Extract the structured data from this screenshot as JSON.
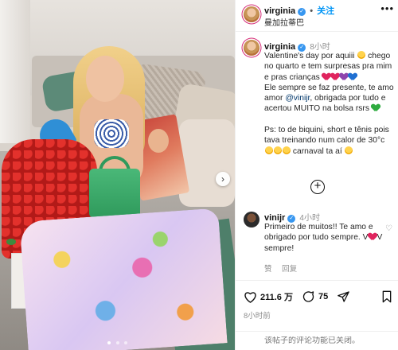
{
  "post": {
    "username": "virginia",
    "follow_label": "关注",
    "location": "曼加拉蒂巴",
    "verified_mark": "✓"
  },
  "caption": {
    "username": "virginia",
    "time": "8小时",
    "line1": "Valentine's day por aquiii ",
    "line2": " chego no quarto e tem surpresas pra mim e pras crianças ",
    "line3": "\nEle sempre se faz presente, te amo amor ",
    "mention": "@vinijr",
    "line4": ", obrigada por tudo e acertou MUITO na bolsa rsrs ",
    "line5": "\n\nPs: to de biquini, short e tênis pois tava treinando num calor de 30°c ",
    "line6": " carnaval ta aí ",
    "heart_colors": [
      "#e0245e",
      "#e0245e",
      "#8e44ad",
      "#1f6fd1"
    ],
    "green_heart_color": "#2eab3f"
  },
  "comment": {
    "username": "vinijr",
    "time": "4小时",
    "text_a": "Primeiro de muitos!! Te amo e obrigado por tudo sempre. V",
    "text_b": "V sempre!",
    "like_action": "赞",
    "reply_action": "回复"
  },
  "stats": {
    "likes": "211.6 万",
    "comments": "75",
    "posted": "8小时前"
  },
  "add_comment": {
    "placeholder": "该帖子的评论功能已关闭。"
  },
  "icons": {
    "like": "heart-outline-icon",
    "comment": "speech-bubble-icon",
    "share": "paper-plane-icon",
    "save": "bookmark-icon",
    "more": "more-dots-icon",
    "next": "chevron-right-icon",
    "load_more": "plus-circle-icon"
  }
}
